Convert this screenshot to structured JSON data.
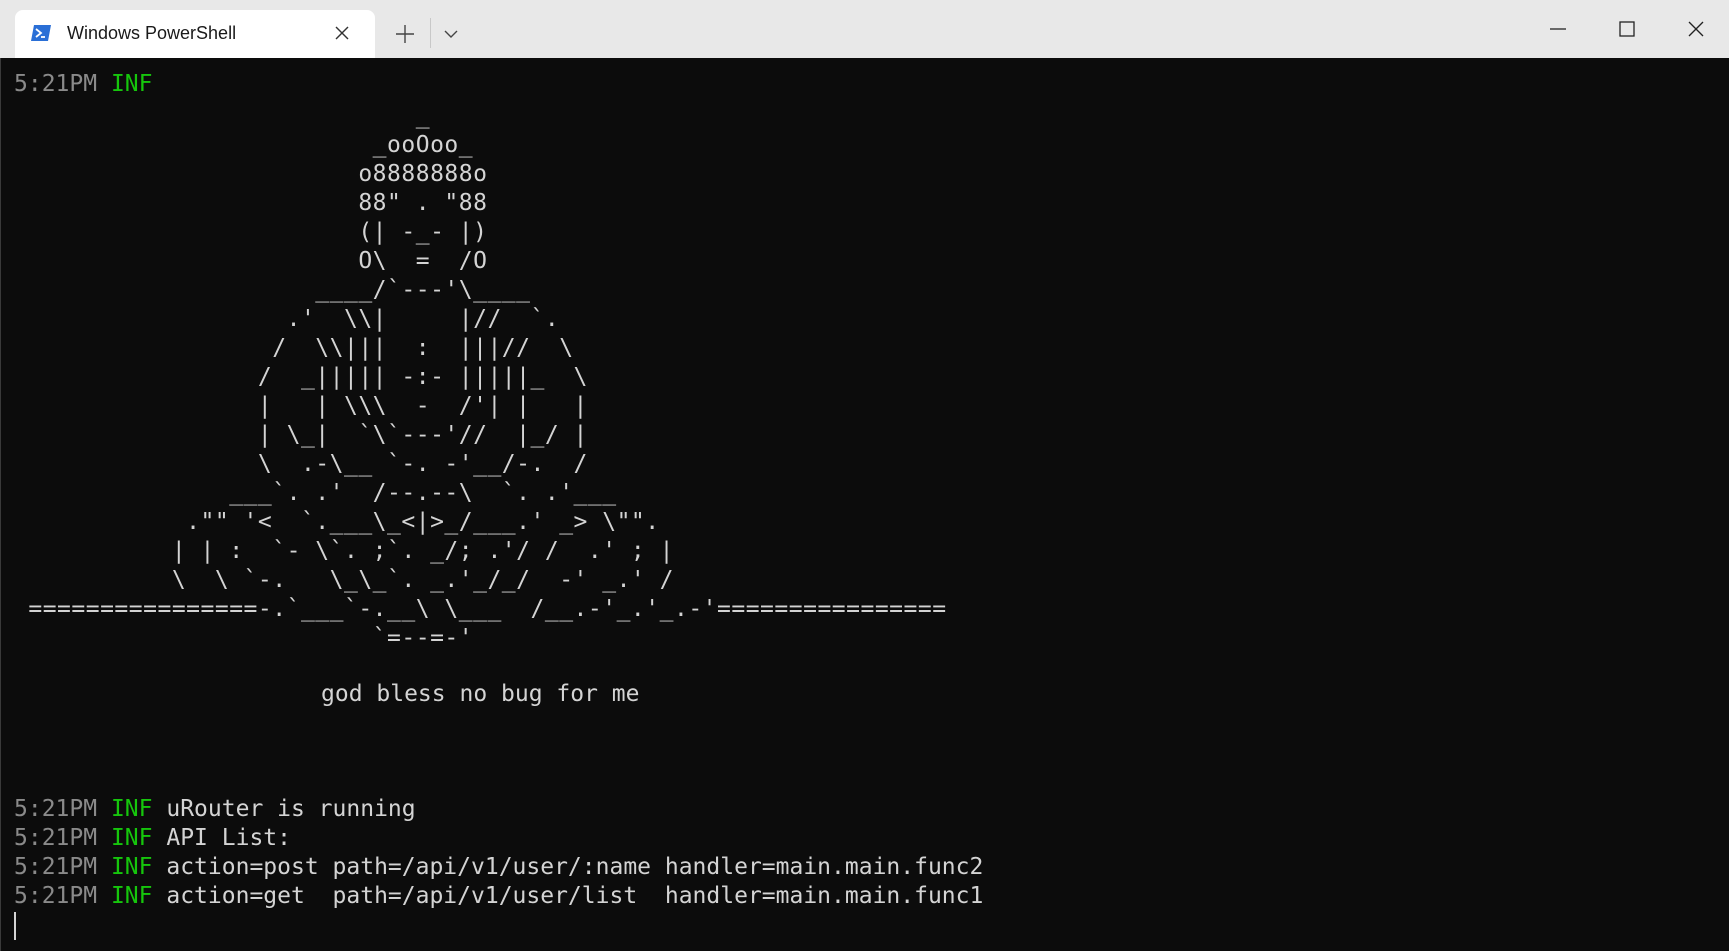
{
  "tab": {
    "title": "Windows PowerShell",
    "icon": "powershell-icon",
    "close_icon": "close-icon"
  },
  "titlebar": {
    "new_tab_icon": "plus-icon",
    "dropdown_icon": "chevron-down-icon",
    "minimize_icon": "minimize-icon",
    "maximize_icon": "maximize-icon",
    "close_icon": "close-icon"
  },
  "colors": {
    "timestamp": "#8a8a8a",
    "level": "#16c60c",
    "text": "#d4d4d4",
    "background": "#0c0c0c"
  },
  "log_first": {
    "time": "5:21PM",
    "level": "INF"
  },
  "ascii_art": "                            _\n                         _ooOoo_\n                        o8888888o\n                        88\" . \"88\n                        (| -_- |)\n                        O\\  =  /O\n                     ____/`---'\\____\n                   .'  \\\\|     |//  `.\n                  /  \\\\|||  :  |||//  \\\n                 /  _||||| -:- |||||_  \\\n                 |   | \\\\\\  -  /'| |   |\n                 | \\_|  `\\`---'//  |_/ |\n                 \\  .-\\__ `-. -'__/-.  /\n               ___`. .'  /--.--\\  `. .'___\n            .\"\" '<  `.___\\_<|>_/___.' _> \\\"\".\n           | | :  `- \\`. ;`. _/; .'/ /  .' ; |\n           \\  \\ `-.   \\_\\_`. _.'_/_/  -' _.' /\n ================-.`___`-.__\\ \\___  /__.-'_.'_.-'================\n                         `=--=-'",
  "blessing": "god bless no bug for me",
  "logs": [
    {
      "time": "5:21PM",
      "level": "INF",
      "message": "uRouter is running"
    },
    {
      "time": "5:21PM",
      "level": "INF",
      "message": "API List:"
    },
    {
      "time": "5:21PM",
      "level": "INF",
      "message": "action=post path=/api/v1/user/:name handler=main.main.func2"
    },
    {
      "time": "5:21PM",
      "level": "INF",
      "message": "action=get  path=/api/v1/user/list  handler=main.main.func1"
    }
  ]
}
